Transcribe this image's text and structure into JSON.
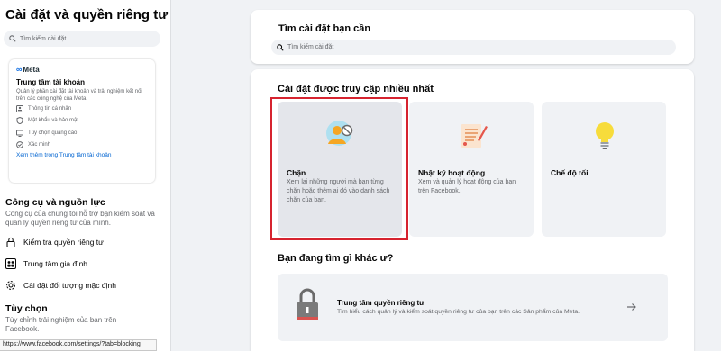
{
  "sidebar": {
    "title": "Cài đặt và quyền riêng tư",
    "search_placeholder": "Tìm kiếm cài đặt",
    "accounts_center": {
      "brand": "Meta",
      "title": "Trung tâm tài khoản",
      "description": "Quản lý phần cài đặt tài khoản và trải nghiệm kết nối trên các công nghệ của Meta.",
      "items": [
        {
          "label": "Thông tin cá nhân",
          "icon": "person-card-icon"
        },
        {
          "label": "Mật khẩu và bảo mật",
          "icon": "shield-icon"
        },
        {
          "label": "Tùy chọn quảng cáo",
          "icon": "ad-screen-icon"
        },
        {
          "label": "Xác minh",
          "icon": "check-circle-icon"
        }
      ],
      "link": "Xem thêm trong Trung tâm tài khoản"
    },
    "tools_section": {
      "title": "Công cụ và nguồn lực",
      "description": "Công cụ của chúng tôi hỗ trợ bạn kiểm soát và quản lý quyền riêng tư của mình.",
      "items": [
        {
          "label": "Kiểm tra quyền riêng tư",
          "icon": "lock-icon"
        },
        {
          "label": "Trung tâm gia đình",
          "icon": "family-icon"
        },
        {
          "label": "Cài đặt đối tượng mặc định",
          "icon": "gear-icon"
        }
      ]
    },
    "prefs_section": {
      "title": "Tùy chọn",
      "description": "Tùy chỉnh trải nghiệm của bạn trên Facebook."
    }
  },
  "status_url": "https://www.facebook.com/settings/?tab=blocking",
  "main": {
    "search": {
      "heading": "Tìm cài đặt bạn cần",
      "placeholder": "Tìm kiếm cài đặt"
    },
    "most_accessed": {
      "title": "Cài đặt được truy cập nhiều nhất",
      "tiles": [
        {
          "title": "Chặn",
          "description": "Xem lại những người mà bạn từng chặn hoặc thêm ai đó vào danh sách chặn của bạn.",
          "icon": "blocked-person-icon"
        },
        {
          "title": "Nhật ký hoạt động",
          "description": "Xem và quản lý hoạt động của bạn trên Facebook.",
          "icon": "activity-log-icon"
        },
        {
          "title": "Chế độ tối",
          "description": "",
          "icon": "lightbulb-icon"
        }
      ]
    },
    "other": {
      "title": "Bạn đang tìm gì khác ư?",
      "privacy_center": {
        "title": "Trung tâm quyền riêng tư",
        "description": "Tìm hiểu cách quản lý và kiểm soát quyền riêng tư của bạn trên các Sản phẩm của Meta.",
        "icon": "padlock-icon"
      }
    }
  },
  "colors": {
    "highlight": "#d6232f",
    "link": "#0064d1",
    "meta_blue": "#0668e1"
  }
}
